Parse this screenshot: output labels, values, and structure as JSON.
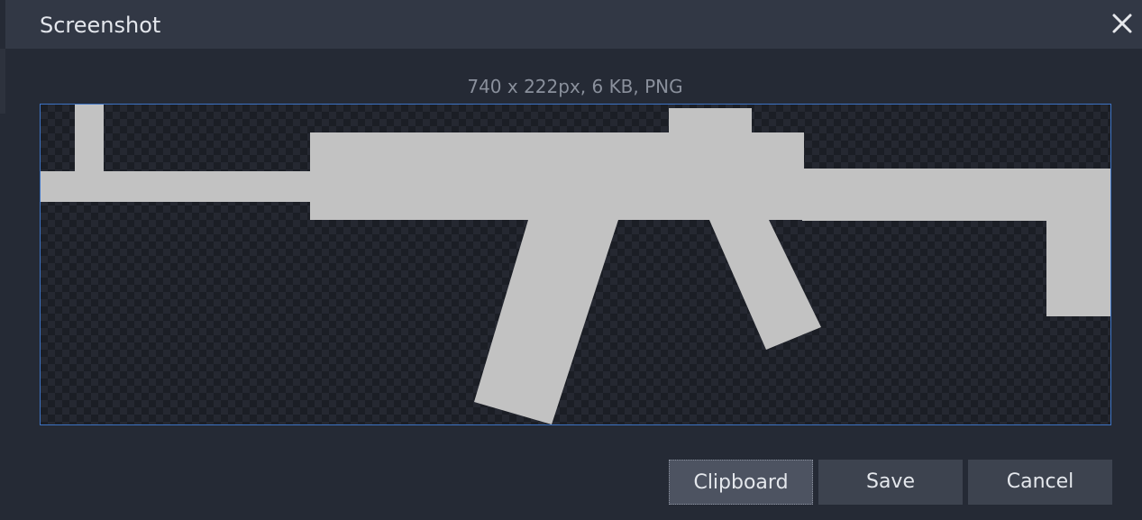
{
  "dialog": {
    "title": "Screenshot",
    "close_icon": "close-icon",
    "image_info": "740 x 222px, 6 KB, PNG",
    "preview_image": "rifle-silhouette",
    "buttons": {
      "clipboard": "Clipboard",
      "save": "Save",
      "cancel": "Cancel"
    }
  },
  "colors": {
    "selection_border": "#3d73c4",
    "silhouette": "#c2c2c2",
    "background": "#252a35"
  }
}
